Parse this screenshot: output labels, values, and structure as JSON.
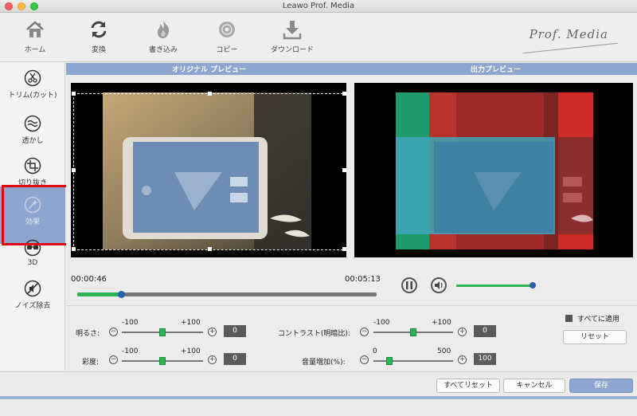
{
  "window": {
    "title": "Leawo Prof. Media"
  },
  "toolbar": {
    "items": [
      {
        "label": "ホーム",
        "icon": "home-icon"
      },
      {
        "label": "変換",
        "icon": "convert-icon"
      },
      {
        "label": "書き込み",
        "icon": "burn-icon"
      },
      {
        "label": "コピー",
        "icon": "disc-copy-icon"
      },
      {
        "label": "ダウンロード",
        "icon": "download-icon"
      }
    ],
    "brand": "Prof. Media"
  },
  "sidebar": {
    "items": [
      {
        "label": "トリム(カット)",
        "icon": "scissors-icon"
      },
      {
        "label": "透かし",
        "icon": "watermark-icon"
      },
      {
        "label": "切り抜き",
        "icon": "crop-icon"
      },
      {
        "label": "効果",
        "icon": "effect-icon",
        "active": true
      },
      {
        "label": "3D",
        "icon": "3d-glasses-icon"
      },
      {
        "label": "ノイズ除去",
        "icon": "noise-removal-icon"
      }
    ]
  },
  "preview": {
    "original_label": "オリジナル プレビュー",
    "output_label": "出力プレビュー"
  },
  "timeline": {
    "current_time": "00:00:46",
    "total_time": "00:05:13",
    "progress_fraction": 0.145,
    "volume_fraction": 1.0
  },
  "adjustments": {
    "brightness": {
      "label": "明るさ:",
      "min_label": "-100",
      "max_label": "+100",
      "value": "0"
    },
    "saturation": {
      "label": "彩度:",
      "min_label": "-100",
      "max_label": "+100",
      "value": "0"
    },
    "contrast": {
      "label": "コントラスト(明暗比):",
      "min_label": "-100",
      "max_label": "+100",
      "value": "0"
    },
    "volume": {
      "label": "音量増加(%):",
      "min_label": "0",
      "max_label": "500",
      "value": "100"
    },
    "apply_all_label": "すべてに適用",
    "reset_label": "リセット"
  },
  "footer": {
    "reset_all_label": "すべてリセット",
    "cancel_label": "キャンセル",
    "save_label": "保存"
  },
  "colors": {
    "accent": "#8ea6cf",
    "slider_green": "#2db555",
    "knob_blue": "#2a5fb0",
    "highlight_red": "#e3000f"
  }
}
